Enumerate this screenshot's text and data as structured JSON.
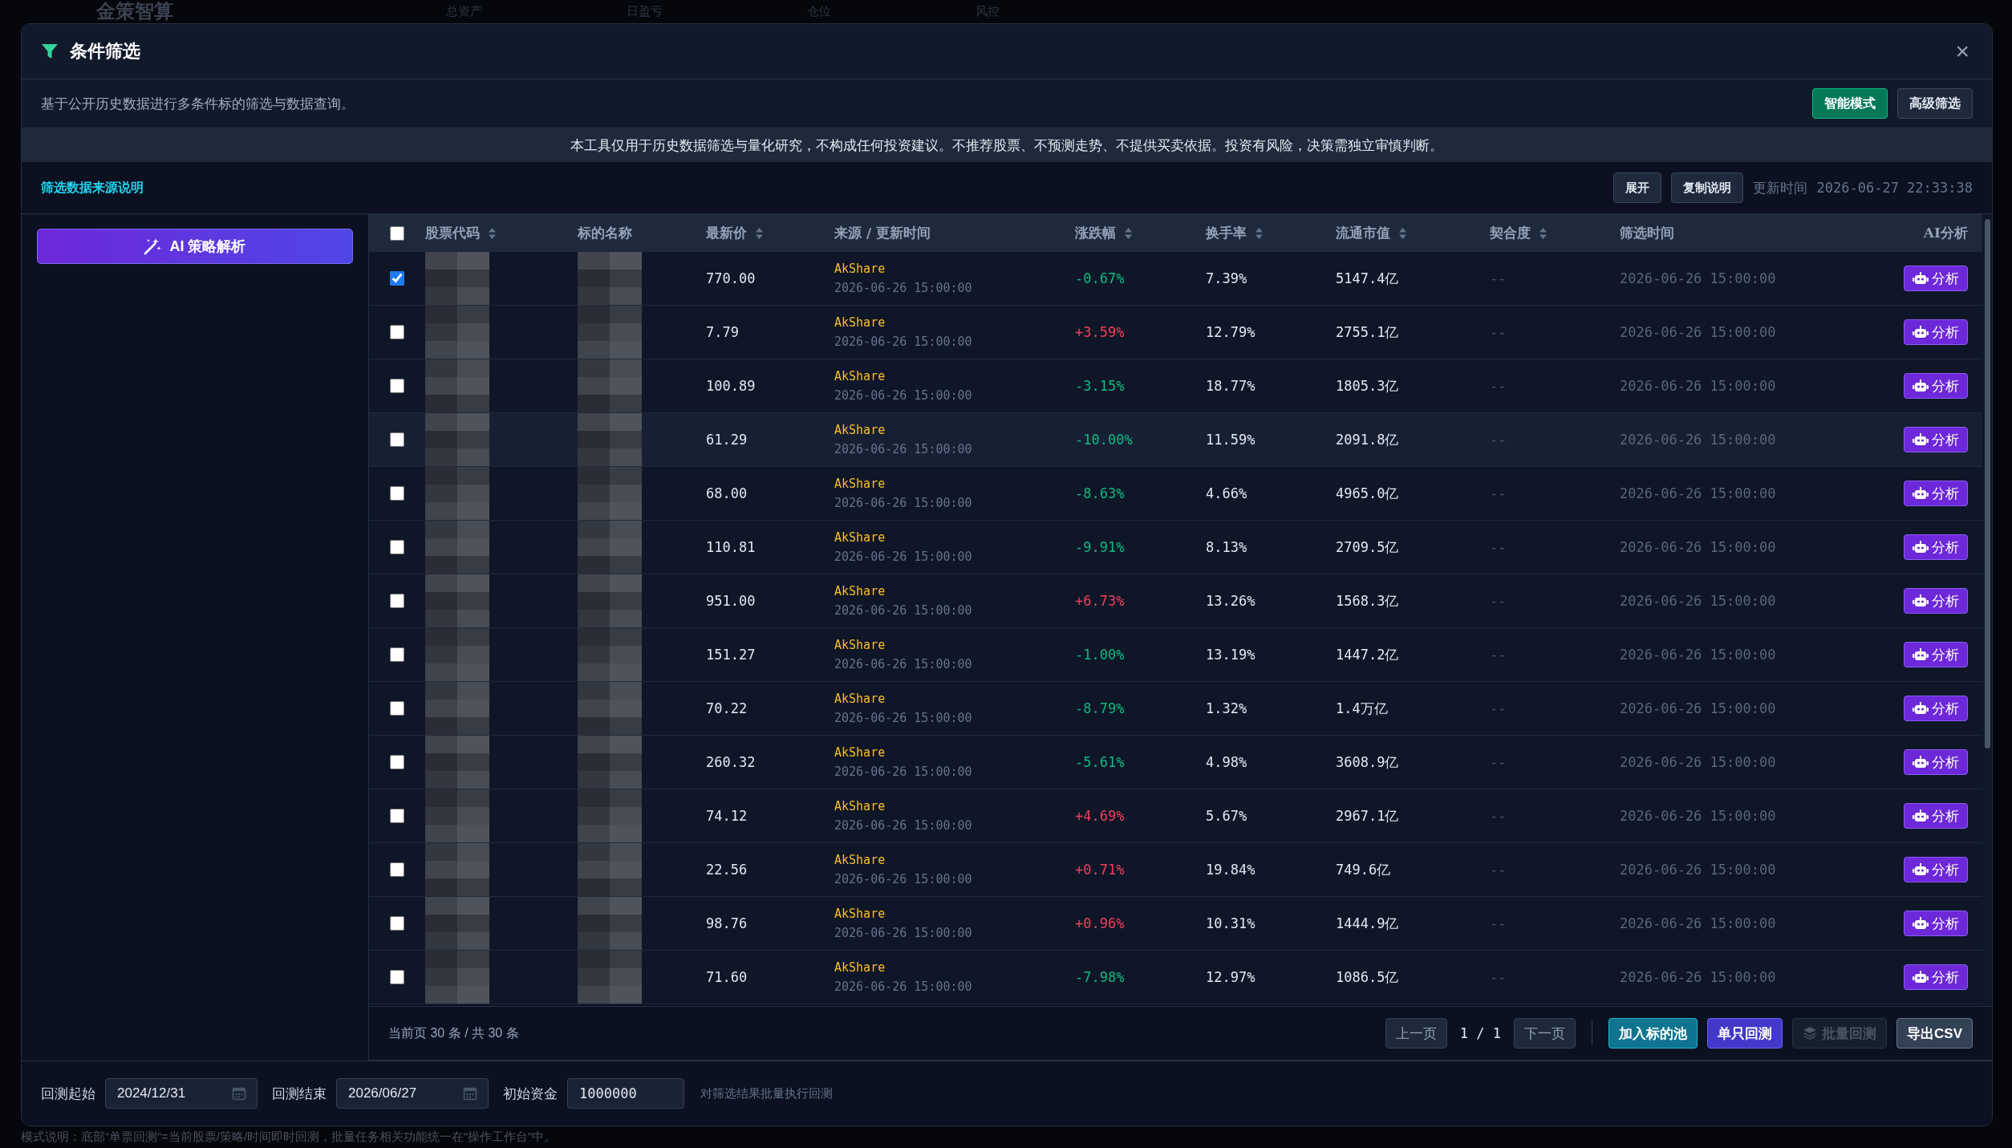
{
  "backdrop": {
    "app_title": "金策智算",
    "stats": [
      "总资产",
      "日盈亏",
      "仓位",
      "风控"
    ],
    "footer_note": "模式说明：底部“单票回测”=当前股票/策略/时间即时回测，批量任务相关功能统一在“操作工作台”中。"
  },
  "dialog": {
    "title": "条件筛选",
    "close": "×",
    "description": "基于公开历史数据进行多条件标的筛选与数据查询。",
    "mode_buttons": [
      {
        "label": "智能模式",
        "selected": true
      },
      {
        "label": "高级筛选",
        "selected": false
      }
    ],
    "disclaimer": "本工具仅用于历史数据筛选与量化研究，不构成任何投资建议。不推荐股票、不预测走势、不提供买卖依据。投资有风险，决策需独立审慎判断。",
    "source_link": "筛选数据来源说明",
    "expand_button": "展开",
    "copy_button": "复制说明",
    "updated_label": "更新时间",
    "updated_time": "2026-06-27 22:33:38"
  },
  "sidebar": {
    "ai_button": "AI 策略解析"
  },
  "table": {
    "select_all": false,
    "columns": [
      {
        "label": "股票代码",
        "sortable": true
      },
      {
        "label": "标的名称",
        "sortable": false
      },
      {
        "label": "最新价",
        "sortable": true
      },
      {
        "label": "来源 / 更新时间",
        "sortable": false
      },
      {
        "label": "涨跌幅",
        "sortable": true
      },
      {
        "label": "换手率",
        "sortable": true
      },
      {
        "label": "流通市值",
        "sortable": true
      },
      {
        "label": "契合度",
        "sortable": true
      },
      {
        "label": "筛选时间",
        "sortable": false
      },
      {
        "label": "AI分析",
        "sortable": false
      }
    ],
    "rows": [
      {
        "selected": true,
        "hovered": false,
        "price": "770.00",
        "source": "AkShare",
        "updated": "2026-06-26 15:00:00",
        "change": "-0.67%",
        "color": "#10b981",
        "turnover": "7.39%",
        "market_cap": "5147.4亿",
        "fit": "--",
        "screen_time": "2026-06-26 15:00:00",
        "action": "分析"
      },
      {
        "selected": false,
        "hovered": false,
        "price": "7.79",
        "source": "AkShare",
        "updated": "2026-06-26 15:00:00",
        "change": "+3.59%",
        "color": "#f43f5e",
        "turnover": "12.79%",
        "market_cap": "2755.1亿",
        "fit": "--",
        "screen_time": "2026-06-26 15:00:00",
        "action": "分析"
      },
      {
        "selected": false,
        "hovered": false,
        "price": "100.89",
        "source": "AkShare",
        "updated": "2026-06-26 15:00:00",
        "change": "-3.15%",
        "color": "#10b981",
        "turnover": "18.77%",
        "market_cap": "1805.3亿",
        "fit": "--",
        "screen_time": "2026-06-26 15:00:00",
        "action": "分析"
      },
      {
        "selected": false,
        "hovered": true,
        "price": "61.29",
        "source": "AkShare",
        "updated": "2026-06-26 15:00:00",
        "change": "-10.00%",
        "color": "#10b981",
        "turnover": "11.59%",
        "market_cap": "2091.8亿",
        "fit": "--",
        "screen_time": "2026-06-26 15:00:00",
        "action": "分析"
      },
      {
        "selected": false,
        "hovered": false,
        "price": "68.00",
        "source": "AkShare",
        "updated": "2026-06-26 15:00:00",
        "change": "-8.63%",
        "color": "#10b981",
        "turnover": "4.66%",
        "market_cap": "4965.0亿",
        "fit": "--",
        "screen_time": "2026-06-26 15:00:00",
        "action": "分析"
      },
      {
        "selected": false,
        "hovered": false,
        "price": "110.81",
        "source": "AkShare",
        "updated": "2026-06-26 15:00:00",
        "change": "-9.91%",
        "color": "#10b981",
        "turnover": "8.13%",
        "market_cap": "2709.5亿",
        "fit": "--",
        "screen_time": "2026-06-26 15:00:00",
        "action": "分析"
      },
      {
        "selected": false,
        "hovered": false,
        "price": "951.00",
        "source": "AkShare",
        "updated": "2026-06-26 15:00:00",
        "change": "+6.73%",
        "color": "#f43f5e",
        "turnover": "13.26%",
        "market_cap": "1568.3亿",
        "fit": "--",
        "screen_time": "2026-06-26 15:00:00",
        "action": "分析"
      },
      {
        "selected": false,
        "hovered": false,
        "price": "151.27",
        "source": "AkShare",
        "updated": "2026-06-26 15:00:00",
        "change": "-1.00%",
        "color": "#10b981",
        "turnover": "13.19%",
        "market_cap": "1447.2亿",
        "fit": "--",
        "screen_time": "2026-06-26 15:00:00",
        "action": "分析"
      },
      {
        "selected": false,
        "hovered": false,
        "price": "70.22",
        "source": "AkShare",
        "updated": "2026-06-26 15:00:00",
        "change": "-8.79%",
        "color": "#10b981",
        "turnover": "1.32%",
        "market_cap": "1.4万亿",
        "fit": "--",
        "screen_time": "2026-06-26 15:00:00",
        "action": "分析"
      },
      {
        "selected": false,
        "hovered": false,
        "price": "260.32",
        "source": "AkShare",
        "updated": "2026-06-26 15:00:00",
        "change": "-5.61%",
        "color": "#10b981",
        "turnover": "4.98%",
        "market_cap": "3608.9亿",
        "fit": "--",
        "screen_time": "2026-06-26 15:00:00",
        "action": "分析"
      },
      {
        "selected": false,
        "hovered": false,
        "price": "74.12",
        "source": "AkShare",
        "updated": "2026-06-26 15:00:00",
        "change": "+4.69%",
        "color": "#f43f5e",
        "turnover": "5.67%",
        "market_cap": "2967.1亿",
        "fit": "--",
        "screen_time": "2026-06-26 15:00:00",
        "action": "分析"
      },
      {
        "selected": false,
        "hovered": false,
        "price": "22.56",
        "source": "AkShare",
        "updated": "2026-06-26 15:00:00",
        "change": "+0.71%",
        "color": "#f43f5e",
        "turnover": "19.84%",
        "market_cap": "749.6亿",
        "fit": "--",
        "screen_time": "2026-06-26 15:00:00",
        "action": "分析"
      },
      {
        "selected": false,
        "hovered": false,
        "price": "98.76",
        "source": "AkShare",
        "updated": "2026-06-26 15:00:00",
        "change": "+0.96%",
        "color": "#f43f5e",
        "turnover": "10.31%",
        "market_cap": "1444.9亿",
        "fit": "--",
        "screen_time": "2026-06-26 15:00:00",
        "action": "分析"
      },
      {
        "selected": false,
        "hovered": false,
        "price": "71.60",
        "source": "AkShare",
        "updated": "2026-06-26 15:00:00",
        "change": "-7.98%",
        "color": "#10b981",
        "turnover": "12.97%",
        "market_cap": "1086.5亿",
        "fit": "--",
        "screen_time": "2026-06-26 15:00:00",
        "action": "分析"
      }
    ]
  },
  "pager": {
    "summary": "当前页 30 条 / 共 30 条",
    "prev": "上一页",
    "page": "1 / 1",
    "next": "下一页",
    "actions": [
      {
        "label": "加入标的池",
        "kind": "teal",
        "disabled": false
      },
      {
        "label": "单只回测",
        "kind": "indigo",
        "disabled": false
      },
      {
        "label": "批量回测",
        "kind": "layers",
        "disabled": true
      },
      {
        "label": "导出CSV",
        "kind": "plain",
        "disabled": false
      }
    ]
  },
  "backtest": {
    "fields": [
      {
        "label": "回测起始",
        "value": "2024/12/31",
        "kind": "date"
      },
      {
        "label": "回测结束",
        "value": "2026/06/27",
        "kind": "date"
      },
      {
        "label": "初始资金",
        "value": "1000000",
        "kind": "number"
      }
    ],
    "hint": "对筛选结果批量执行回测"
  }
}
